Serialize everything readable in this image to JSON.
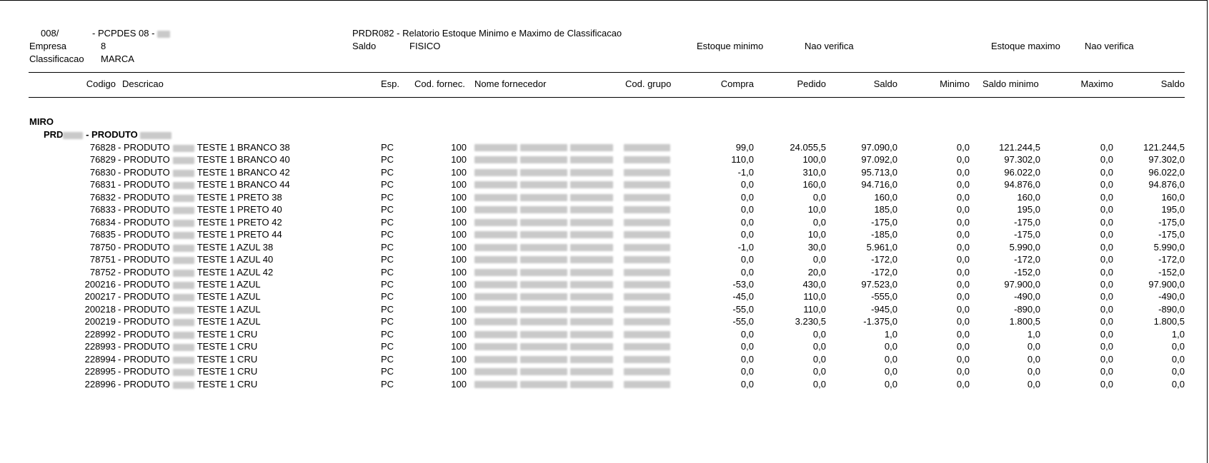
{
  "header": {
    "code_prefix": "008/",
    "report_dash": "- PCPDES 08 -",
    "report_title": "PRDR082 - Relatorio Estoque Minimo e Maximo de Classificacao",
    "empresa_label": "Empresa",
    "empresa_value": "8",
    "saldo_label": "Saldo",
    "saldo_value": "FISICO",
    "estoque_minimo_label": "Estoque minimo",
    "estoque_minimo_value": "Nao verifica",
    "estoque_maximo_label": "Estoque maximo",
    "estoque_maximo_value": "Nao verifica",
    "classificacao_label": "Classificacao",
    "classificacao_value": "MARCA"
  },
  "columns": {
    "codigo": "Codigo",
    "descricao": "Descricao",
    "esp": "Esp.",
    "cod_fornec": "Cod. fornec.",
    "nome_fornecedor": "Nome fornecedor",
    "cod_grupo": "Cod. grupo",
    "compra": "Compra",
    "pedido": "Pedido",
    "saldo": "Saldo",
    "minimo": "Minimo",
    "saldo_minimo": "Saldo minimo",
    "maximo": "Maximo",
    "saldo_final": "Saldo"
  },
  "group": {
    "name": "MIRO",
    "subgroup_prefix": "PRD",
    "subgroup_suffix": "- PRODUTO"
  },
  "rows": [
    {
      "codigo": "76828",
      "desc_prefix": "- PRODUTO",
      "desc_suffix": "TESTE 1 BRANCO 38",
      "esp": "PC",
      "cod_fornec": "100",
      "compra": "99,0",
      "pedido": "24.055,5",
      "saldo": "97.090,0",
      "minimo": "0,0",
      "saldo_minimo": "121.244,5",
      "maximo": "0,0",
      "saldo_final": "121.244,5"
    },
    {
      "codigo": "76829",
      "desc_prefix": "- PRODUTO",
      "desc_suffix": "TESTE 1 BRANCO 40",
      "esp": "PC",
      "cod_fornec": "100",
      "compra": "110,0",
      "pedido": "100,0",
      "saldo": "97.092,0",
      "minimo": "0,0",
      "saldo_minimo": "97.302,0",
      "maximo": "0,0",
      "saldo_final": "97.302,0"
    },
    {
      "codigo": "76830",
      "desc_prefix": "- PRODUTO",
      "desc_suffix": "TESTE 1 BRANCO 42",
      "esp": "PC",
      "cod_fornec": "100",
      "compra": "-1,0",
      "pedido": "310,0",
      "saldo": "95.713,0",
      "minimo": "0,0",
      "saldo_minimo": "96.022,0",
      "maximo": "0,0",
      "saldo_final": "96.022,0"
    },
    {
      "codigo": "76831",
      "desc_prefix": "- PRODUTO",
      "desc_suffix": "TESTE 1 BRANCO 44",
      "esp": "PC",
      "cod_fornec": "100",
      "compra": "0,0",
      "pedido": "160,0",
      "saldo": "94.716,0",
      "minimo": "0,0",
      "saldo_minimo": "94.876,0",
      "maximo": "0,0",
      "saldo_final": "94.876,0"
    },
    {
      "codigo": "76832",
      "desc_prefix": "- PRODUTO",
      "desc_suffix": "TESTE 1 PRETO 38",
      "esp": "PC",
      "cod_fornec": "100",
      "compra": "0,0",
      "pedido": "0,0",
      "saldo": "160,0",
      "minimo": "0,0",
      "saldo_minimo": "160,0",
      "maximo": "0,0",
      "saldo_final": "160,0"
    },
    {
      "codigo": "76833",
      "desc_prefix": "- PRODUTO",
      "desc_suffix": "TESTE 1 PRETO 40",
      "esp": "PC",
      "cod_fornec": "100",
      "compra": "0,0",
      "pedido": "10,0",
      "saldo": "185,0",
      "minimo": "0,0",
      "saldo_minimo": "195,0",
      "maximo": "0,0",
      "saldo_final": "195,0"
    },
    {
      "codigo": "76834",
      "desc_prefix": "- PRODUTO",
      "desc_suffix": "TESTE 1 PRETO 42",
      "esp": "PC",
      "cod_fornec": "100",
      "compra": "0,0",
      "pedido": "0,0",
      "saldo": "-175,0",
      "minimo": "0,0",
      "saldo_minimo": "-175,0",
      "maximo": "0,0",
      "saldo_final": "-175,0"
    },
    {
      "codigo": "76835",
      "desc_prefix": "- PRODUTO",
      "desc_suffix": "TESTE 1 PRETO 44",
      "esp": "PC",
      "cod_fornec": "100",
      "compra": "0,0",
      "pedido": "10,0",
      "saldo": "-185,0",
      "minimo": "0,0",
      "saldo_minimo": "-175,0",
      "maximo": "0,0",
      "saldo_final": "-175,0"
    },
    {
      "codigo": "78750",
      "desc_prefix": "- PRODUTO",
      "desc_suffix": "TESTE 1 AZUL 38",
      "esp": "PC",
      "cod_fornec": "100",
      "compra": "-1,0",
      "pedido": "30,0",
      "saldo": "5.961,0",
      "minimo": "0,0",
      "saldo_minimo": "5.990,0",
      "maximo": "0,0",
      "saldo_final": "5.990,0"
    },
    {
      "codigo": "78751",
      "desc_prefix": "- PRODUTO",
      "desc_suffix": "TESTE 1 AZUL 40",
      "esp": "PC",
      "cod_fornec": "100",
      "compra": "0,0",
      "pedido": "0,0",
      "saldo": "-172,0",
      "minimo": "0,0",
      "saldo_minimo": "-172,0",
      "maximo": "0,0",
      "saldo_final": "-172,0"
    },
    {
      "codigo": "78752",
      "desc_prefix": "- PRODUTO",
      "desc_suffix": "TESTE 1 AZUL 42",
      "esp": "PC",
      "cod_fornec": "100",
      "compra": "0,0",
      "pedido": "20,0",
      "saldo": "-172,0",
      "minimo": "0,0",
      "saldo_minimo": "-152,0",
      "maximo": "0,0",
      "saldo_final": "-152,0"
    },
    {
      "codigo": "200216",
      "desc_prefix": "- PRODUTO",
      "desc_suffix": "TESTE 1 AZUL",
      "esp": "PC",
      "cod_fornec": "100",
      "compra": "-53,0",
      "pedido": "430,0",
      "saldo": "97.523,0",
      "minimo": "0,0",
      "saldo_minimo": "97.900,0",
      "maximo": "0,0",
      "saldo_final": "97.900,0"
    },
    {
      "codigo": "200217",
      "desc_prefix": "- PRODUTO",
      "desc_suffix": "TESTE 1 AZUL",
      "esp": "PC",
      "cod_fornec": "100",
      "compra": "-45,0",
      "pedido": "110,0",
      "saldo": "-555,0",
      "minimo": "0,0",
      "saldo_minimo": "-490,0",
      "maximo": "0,0",
      "saldo_final": "-490,0"
    },
    {
      "codigo": "200218",
      "desc_prefix": "- PRODUTO",
      "desc_suffix": "TESTE 1 AZUL",
      "esp": "PC",
      "cod_fornec": "100",
      "compra": "-55,0",
      "pedido": "110,0",
      "saldo": "-945,0",
      "minimo": "0,0",
      "saldo_minimo": "-890,0",
      "maximo": "0,0",
      "saldo_final": "-890,0"
    },
    {
      "codigo": "200219",
      "desc_prefix": "- PRODUTO",
      "desc_suffix": "TESTE 1 AZUL",
      "esp": "PC",
      "cod_fornec": "100",
      "compra": "-55,0",
      "pedido": "3.230,5",
      "saldo": "-1.375,0",
      "minimo": "0,0",
      "saldo_minimo": "1.800,5",
      "maximo": "0,0",
      "saldo_final": "1.800,5"
    },
    {
      "codigo": "228992",
      "desc_prefix": "- PRODUTO",
      "desc_suffix": "TESTE 1 CRU",
      "esp": "PC",
      "cod_fornec": "100",
      "compra": "0,0",
      "pedido": "0,0",
      "saldo": "1,0",
      "minimo": "0,0",
      "saldo_minimo": "1,0",
      "maximo": "0,0",
      "saldo_final": "1,0"
    },
    {
      "codigo": "228993",
      "desc_prefix": "- PRODUTO",
      "desc_suffix": "TESTE 1 CRU",
      "esp": "PC",
      "cod_fornec": "100",
      "compra": "0,0",
      "pedido": "0,0",
      "saldo": "0,0",
      "minimo": "0,0",
      "saldo_minimo": "0,0",
      "maximo": "0,0",
      "saldo_final": "0,0"
    },
    {
      "codigo": "228994",
      "desc_prefix": "- PRODUTO",
      "desc_suffix": "TESTE 1 CRU",
      "esp": "PC",
      "cod_fornec": "100",
      "compra": "0,0",
      "pedido": "0,0",
      "saldo": "0,0",
      "minimo": "0,0",
      "saldo_minimo": "0,0",
      "maximo": "0,0",
      "saldo_final": "0,0"
    },
    {
      "codigo": "228995",
      "desc_prefix": "- PRODUTO",
      "desc_suffix": "TESTE 1 CRU",
      "esp": "PC",
      "cod_fornec": "100",
      "compra": "0,0",
      "pedido": "0,0",
      "saldo": "0,0",
      "minimo": "0,0",
      "saldo_minimo": "0,0",
      "maximo": "0,0",
      "saldo_final": "0,0"
    },
    {
      "codigo": "228996",
      "desc_prefix": "- PRODUTO",
      "desc_suffix": "TESTE 1 CRU",
      "esp": "PC",
      "cod_fornec": "100",
      "compra": "0,0",
      "pedido": "0,0",
      "saldo": "0,0",
      "minimo": "0,0",
      "saldo_minimo": "0,0",
      "maximo": "0,0",
      "saldo_final": "0,0"
    }
  ]
}
